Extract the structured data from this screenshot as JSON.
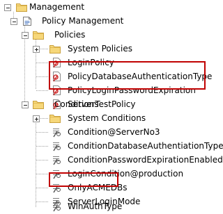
{
  "tree": {
    "root": {
      "label": "Management",
      "icon": "folder-icon",
      "expanded": true
    },
    "policy_management": {
      "label": "Policy Management",
      "icon": "policy-management-icon",
      "expanded": true
    },
    "policies": {
      "label": "Policies",
      "icon": "folder-icon",
      "expanded": true,
      "system_folder": {
        "label": "System Policies",
        "icon": "folder-icon",
        "expanded": false
      },
      "items": [
        {
          "label": "LoginPolicy",
          "icon": "policy-icon",
          "highlighted": false
        },
        {
          "label": "PolicyDatabaseAuthenticationType",
          "icon": "policy-icon",
          "highlighted": true
        },
        {
          "label": "PolicyLoginPasswordExpiration",
          "icon": "policy-icon",
          "highlighted": true
        },
        {
          "label": "ServerTestPolicy",
          "icon": "policy-icon",
          "highlighted": false
        }
      ]
    },
    "conditions": {
      "label": "Conditions",
      "icon": "folder-icon",
      "expanded": true,
      "system_folder": {
        "label": "System Conditions",
        "icon": "folder-icon",
        "expanded": false
      },
      "items": [
        {
          "label": "Condition@ServerNo3",
          "icon": "condition-icon",
          "highlighted": false
        },
        {
          "label": "ConditionDatabaseAuthentiationType",
          "icon": "condition-icon",
          "highlighted": false
        },
        {
          "label": "ConditionPasswordExpirationEnabled",
          "icon": "condition-icon",
          "highlighted": false
        },
        {
          "label": "LoginCondition@production",
          "icon": "condition-icon",
          "highlighted": false
        },
        {
          "label": "OnlyACMEDBs",
          "icon": "condition-icon",
          "highlighted": true
        },
        {
          "label": "ServerLoginMode",
          "icon": "condition-icon",
          "highlighted": false
        },
        {
          "label": "WinAuthType",
          "icon": "condition-icon",
          "highlighted": false
        }
      ]
    }
  },
  "colors": {
    "highlight_border": "#c00000",
    "folder_fill": "#f6d77a",
    "folder_border": "#c9a03c",
    "policy_red": "#cc2a2a",
    "tree_line": "#a0a0a0"
  }
}
